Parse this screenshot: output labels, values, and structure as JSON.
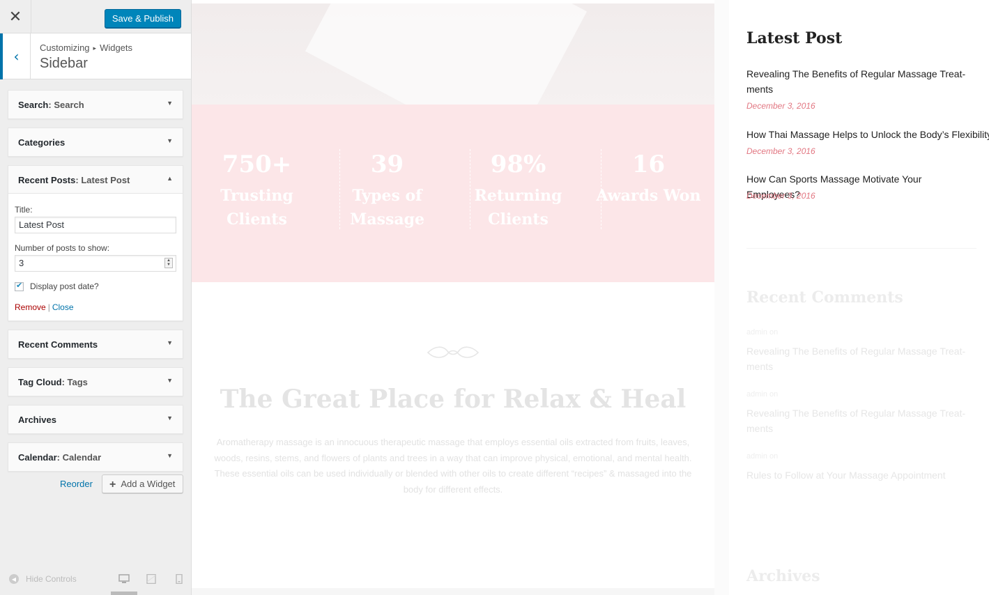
{
  "customizer": {
    "close_icon": "✕",
    "publish_label": "Save & Publish",
    "back_icon": "‹",
    "breadcrumb": [
      "Customizing",
      "Widgets"
    ],
    "breadcrumb_sep": "▸",
    "section_title": "Sidebar",
    "widgets": [
      {
        "name": "Search",
        "instance": ": Search"
      },
      {
        "name": "Categories",
        "instance": ""
      },
      {
        "name": "Recent Posts",
        "instance": ": Latest Post"
      },
      {
        "name": "Recent Comments",
        "instance": ""
      },
      {
        "name": "Tag Cloud",
        "instance": ": Tags"
      },
      {
        "name": "Archives",
        "instance": ""
      },
      {
        "name": "Calendar",
        "instance": ": Calendar"
      }
    ],
    "open_widget_form": {
      "title_label": "Title:",
      "title_value": "Latest Post",
      "number_label": "Number of posts to show:",
      "number_value": "3",
      "display_date_label": "Display post date?",
      "display_date_checked": true,
      "remove_label": "Remove",
      "separator": "|",
      "close_label": "Close"
    },
    "reorder_label": "Reorder",
    "add_widget_label": "Add a Widget",
    "hide_controls_label": "Hide Controls"
  },
  "preview": {
    "stats": [
      {
        "number": "750+",
        "label_1": "Trusting",
        "label_2": "Clients"
      },
      {
        "number": "39",
        "label_1": "Types of",
        "label_2": "Massage"
      },
      {
        "number": "98%",
        "label_1": "Returning",
        "label_2": "Clients"
      },
      {
        "number": "16",
        "label_1": "Awards Won",
        "label_2": ""
      }
    ],
    "heading": "The Great Place for Relax & Heal",
    "intro": "Aromatherapy massage is an innocuous therapeutic massage that employs essential oils extracted from fruits, leaves, woods, resins, stems, and flowers of plants and trees in a way that can improve physical, emotional, and mental health. These essential oils can be used individually or blended with other oils to create different “recipes” & massaged into the body for different effects.",
    "sidebar": {
      "latest_post_heading": "Latest Post",
      "posts": [
        {
          "title_1": "Revealing The Benefits of Regular Massage Treat-",
          "title_2": "ments",
          "date": "December 3, 2016"
        },
        {
          "title_1": "How Thai Massage Helps to Unlock the Body’s Flexibility",
          "title_2": "",
          "date": "December 3, 2016"
        },
        {
          "title_1": "How Can Sports Massage Motivate Your Employees?",
          "title_2": "",
          "date": "December 3, 2016"
        }
      ],
      "recent_comments_heading": "Recent Comments",
      "comments": [
        {
          "meta": "admin  on",
          "title_1": "Revealing The Benefits of Regular Massage Treat-",
          "title_2": "ments"
        },
        {
          "meta": "admin  on",
          "title_1": "Revealing The Benefits of Regular Massage Treat-",
          "title_2": "ments"
        },
        {
          "meta": "admin  on",
          "title_1": "Rules to Follow at Your Massage Appointment",
          "title_2": ""
        }
      ],
      "archives_heading": "Archives"
    }
  },
  "colors": {
    "primary_button": "#0085ba",
    "link": "#0073aa",
    "remove": "#aa0000",
    "stats_bg": "#fce6e8",
    "post_date": "#e27782"
  }
}
